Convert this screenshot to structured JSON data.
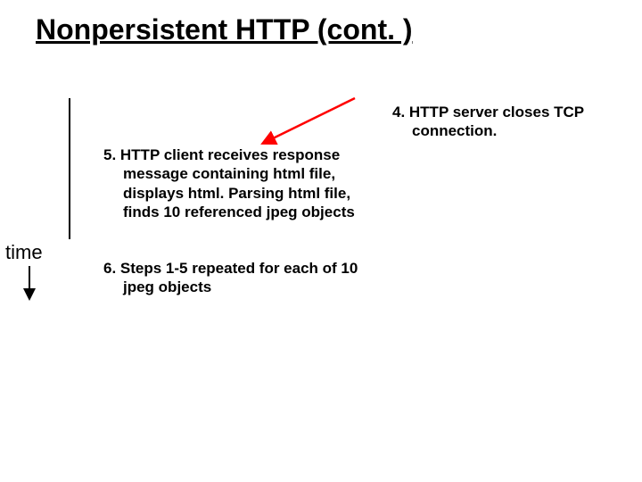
{
  "title": "Nonpersistent HTTP (cont. )",
  "time_label": "time",
  "steps": {
    "s4": "4. HTTP server closes TCP connection.",
    "s5": "5. HTTP client receives response message containing html file, displays html.  Parsing html file, finds 10 referenced jpeg objects",
    "s6": "6. Steps 1-5 repeated for each of 10 jpeg objects"
  },
  "colors": {
    "arrow_red": "#ff0000",
    "axis": "#000000"
  }
}
